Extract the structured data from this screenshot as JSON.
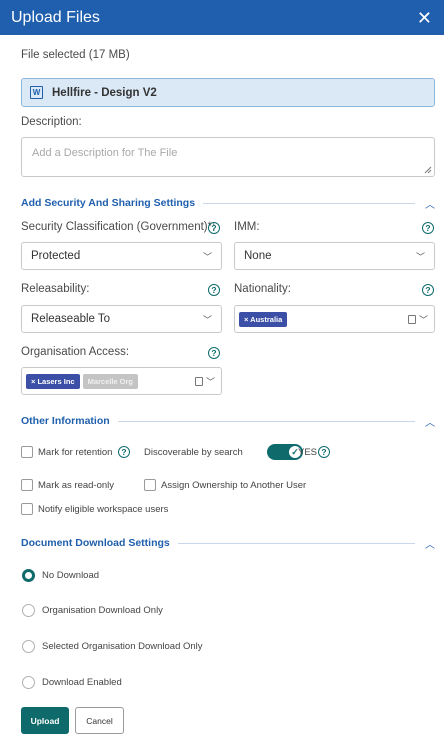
{
  "dialog": {
    "title": "Upload Files",
    "close_symbol": "✕"
  },
  "file": {
    "selected_text": "File selected (17 MB)",
    "icon_letter": "W",
    "name": "Hellfire - Design V2"
  },
  "description": {
    "label": "Description:",
    "placeholder": "Add a Description for The File"
  },
  "security": {
    "heading": "Add Security And Sharing Settings",
    "classification": {
      "label": "Security Classification (Government)*:",
      "value": "Protected"
    },
    "imm": {
      "label": "IMM:",
      "value": "None"
    },
    "releasability": {
      "label": "Releasability:",
      "value": "Releaseable To"
    },
    "nationality": {
      "label": "Nationality:",
      "chips": [
        "× Australia"
      ]
    },
    "organisation": {
      "label": "Organisation Access:",
      "chips": [
        "× Lasers Inc",
        "Marcelle Org"
      ]
    }
  },
  "other": {
    "heading": "Other Information",
    "retention_label": "Mark for retention",
    "discoverable_label": "Discoverable by search",
    "toggle_text": "YES",
    "readonly_label": "Mark as read-only",
    "ownership_label": "Assign Ownership to Another User",
    "notify_label": "Notify eligible workspace users"
  },
  "download": {
    "heading": "Document Download Settings",
    "options": [
      "No Download",
      "Organisation Download Only",
      "Selected Organisation Download Only",
      "Download Enabled"
    ],
    "selected_index": 0
  },
  "actions": {
    "upload": "Upload",
    "cancel": "Cancel"
  },
  "colors": {
    "header": "#1f5fad",
    "accent": "#0f6b6b",
    "chip": "#3b4fa6"
  }
}
